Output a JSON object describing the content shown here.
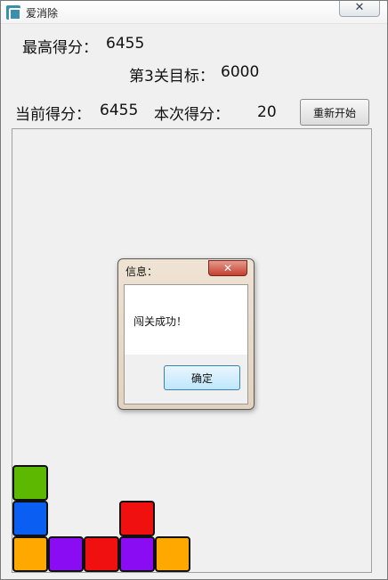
{
  "window": {
    "title": "爱消除",
    "close_label": "✕"
  },
  "scores": {
    "high_label": "最高得分：",
    "high_value": "6455",
    "target_label": "第3关目标：",
    "target_value": "6000",
    "current_label": "当前得分：",
    "current_value": "6455",
    "this_label": "本次得分：",
    "this_value": "20"
  },
  "restart_label": "重新开始",
  "dialog": {
    "title": "信息：",
    "close_label": "✕",
    "message": "闯关成功！",
    "ok_label": "确定"
  },
  "colors": {
    "green": "#5cb800",
    "blue": "#0a5ff2",
    "orange": "#ffa800",
    "purple": "#8a0cf2",
    "red": "#f01010"
  },
  "board": {
    "columns": 10,
    "tiles": [
      {
        "col": 0,
        "row_from_bottom": 2,
        "color": "green"
      },
      {
        "col": 0,
        "row_from_bottom": 1,
        "color": "blue"
      },
      {
        "col": 0,
        "row_from_bottom": 0,
        "color": "orange"
      },
      {
        "col": 1,
        "row_from_bottom": 0,
        "color": "purple"
      },
      {
        "col": 2,
        "row_from_bottom": 0,
        "color": "red"
      },
      {
        "col": 3,
        "row_from_bottom": 1,
        "color": "red"
      },
      {
        "col": 3,
        "row_from_bottom": 0,
        "color": "purple"
      },
      {
        "col": 4,
        "row_from_bottom": 0,
        "color": "orange"
      }
    ]
  }
}
